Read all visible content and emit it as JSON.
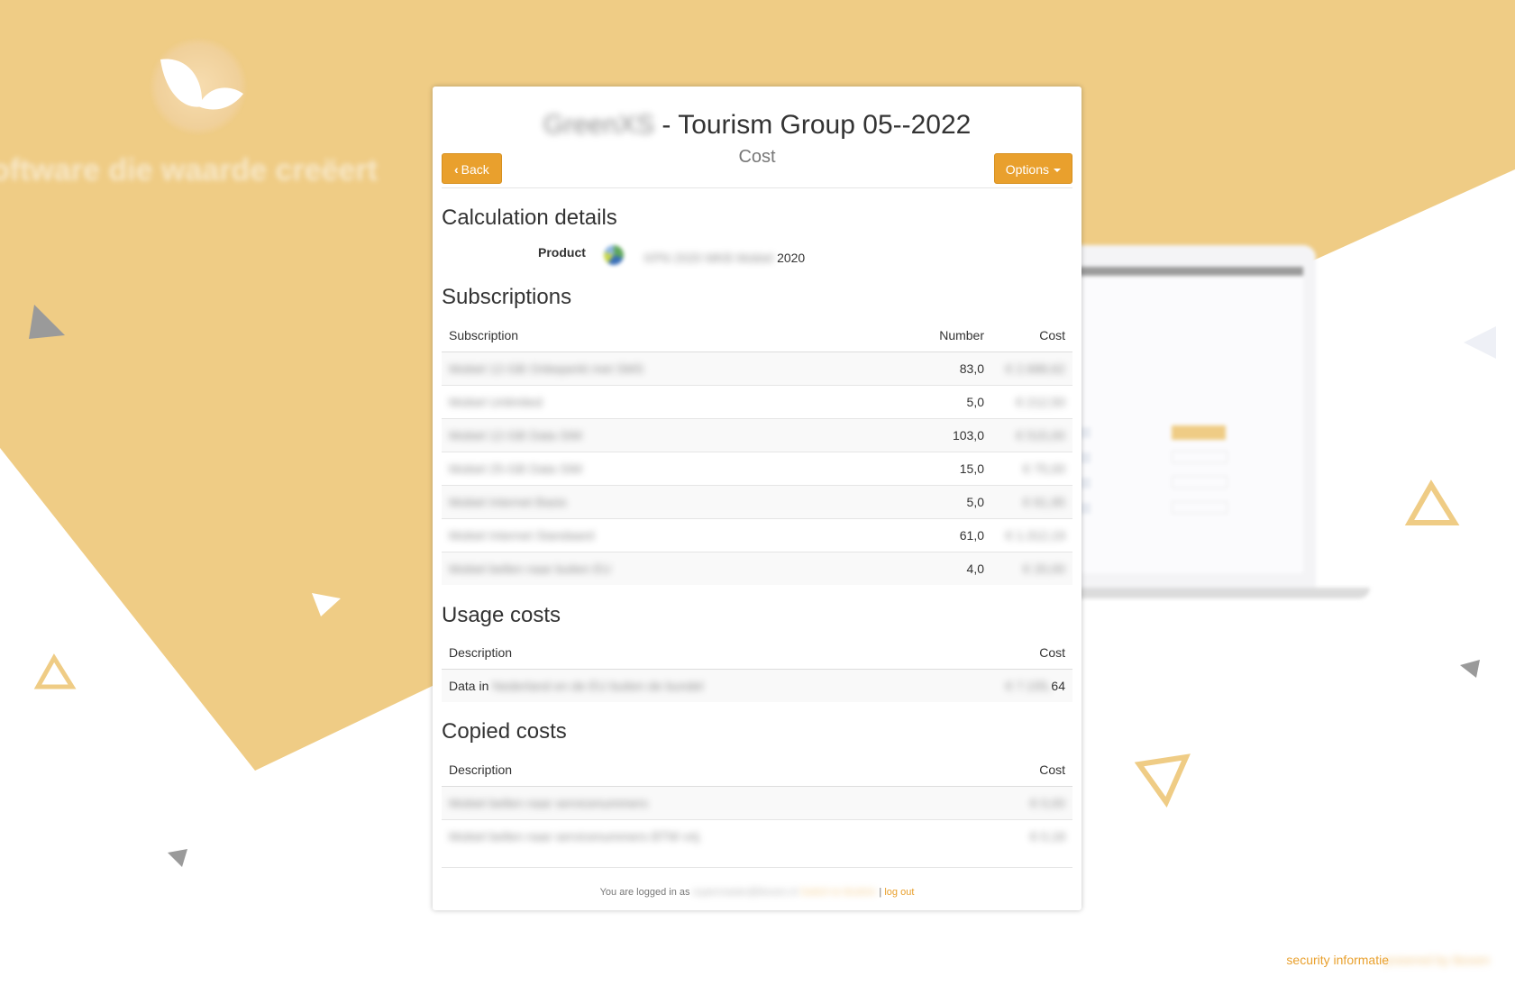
{
  "header": {
    "title_brand": "GreenXS",
    "title_suffix": "- Tourism Group 05--2022",
    "subtitle": "Cost",
    "back_label": "Back",
    "options_label": "Options"
  },
  "background": {
    "tagline": "oftware die waarde creëert"
  },
  "calculation": {
    "heading": "Calculation details",
    "product_label": "Product",
    "product_name_blurred": "KPN 2020 MKB Mobiel",
    "product_name_suffix": "2020"
  },
  "subscriptions": {
    "heading": "Subscriptions",
    "columns": [
      "Subscription",
      "Number",
      "Cost"
    ],
    "rows": [
      {
        "name": "Mobiel 12-GB Onbeperkt met SMS",
        "number": "83,0",
        "cost": "€ 2.688,62"
      },
      {
        "name": "Mobiel Unlimited",
        "number": "5,0",
        "cost": "€ 212,50"
      },
      {
        "name": "Mobiel 12-GB Data SIM",
        "number": "103,0",
        "cost": "€ 515,00"
      },
      {
        "name": "Mobiel 25-GB Data SIM",
        "number": "15,0",
        "cost": "€ 75,00"
      },
      {
        "name": "Mobiel Internet Basis",
        "number": "5,0",
        "cost": "€ 61,95"
      },
      {
        "name": "Mobiel Internet Standaard",
        "number": "61,0",
        "cost": "€ 1.312,19"
      },
      {
        "name": "Mobiel bellen naar buiten EU",
        "number": "4,0",
        "cost": "€ 20,00"
      }
    ]
  },
  "usage": {
    "heading": "Usage costs",
    "columns": [
      "Description",
      "Cost"
    ],
    "rows": [
      {
        "prefix": "Data in",
        "rest": "Nederland en de EU buiten de bundel",
        "cost_blur": "€ 7.155,",
        "cost_end": "64"
      }
    ]
  },
  "copied": {
    "heading": "Copied costs",
    "columns": [
      "Description",
      "Cost"
    ],
    "rows": [
      {
        "name": "Mobiel bellen naar servicenummers",
        "cost_blur": "€ 0,0",
        "cost_end": "0"
      },
      {
        "name": "Mobiel bellen naar servicenummers BTW vrij",
        "cost_blur": "€ 0,",
        "cost_end": "18"
      }
    ]
  },
  "footer": {
    "logged_in_text": "You are logged in as",
    "user_email": "supermaster@iboxen.nl",
    "switch_label": "Switch to Ibrahim",
    "separator": "|",
    "logout_label": "log out"
  },
  "page_footer": {
    "security_label": "security informatie",
    "powered_label": "powered by iboxen"
  }
}
